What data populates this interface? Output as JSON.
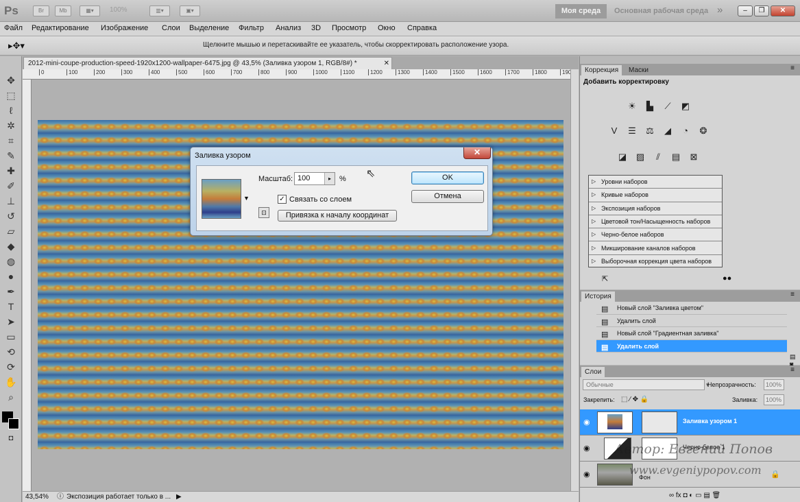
{
  "app": {
    "logo": "Ps",
    "zoom": "100%",
    "ws_active": "Моя среда",
    "ws_main": "Основная рабочая среда",
    "more": "»"
  },
  "menu": [
    "Файл",
    "Редактирование",
    "Изображение",
    "Слои",
    "Выделение",
    "Фильтр",
    "Анализ",
    "3D",
    "Просмотр",
    "Окно",
    "Справка"
  ],
  "options": {
    "hint": "Щелкните мышью и перетаскивайте ее указатель, чтобы скорректировать расположение узора."
  },
  "document": {
    "tab_title": "2012-mini-coupe-production-speed-1920x1200-wallpaper-6475.jpg @ 43,5% (Заливка узором 1, RGB/8#) *",
    "ruler_labels": [
      "0",
      "100",
      "200",
      "300",
      "400",
      "500",
      "600",
      "700",
      "800",
      "900",
      "1000",
      "1100",
      "1200",
      "1300",
      "1400",
      "1500",
      "1600",
      "1700",
      "1800",
      "190"
    ],
    "zoom_status": "43,54%",
    "status_text": "Экспозиция работает только в ..."
  },
  "dialog": {
    "title": "Заливка узором",
    "close": "✕",
    "scale_label": "Масштаб:",
    "scale_value": "100",
    "percent": "%",
    "link_label": "Связать со слоем",
    "link_checked": true,
    "origin_button": "Привязка к началу координат",
    "ok": "OK",
    "cancel": "Отмена"
  },
  "adjustments": {
    "tabs": [
      "Коррекция",
      "Маски"
    ],
    "heading": "Добавить корректировку",
    "presets": [
      "Уровни наборов",
      "Кривые наборов",
      "Экспозиция наборов",
      "Цветовой тон/Насыщенность наборов",
      "Черно-белое наборов",
      "Микширование каналов наборов",
      "Выборочная коррекция цвета наборов"
    ]
  },
  "history": {
    "tab": "История",
    "items": [
      "Новый слой \"Заливка цветом\"",
      "Удалить слой",
      "Новый слой \"Градиентная заливка\"",
      "Удалить слой"
    ],
    "selected_index": 3
  },
  "layers": {
    "tab": "Слои",
    "blend_mode": "Обычные",
    "opacity_label": "Непрозрачность:",
    "opacity": "100%",
    "lock_label": "Закрепить:",
    "fill_label": "Заливка:",
    "fill": "100%",
    "items": [
      "Заливка узором 1",
      "Черно-белое 1",
      "Фон"
    ]
  },
  "watermark": {
    "author": "Автор: Евгений Попов",
    "site": "www.evgeniypopov.com"
  },
  "colors": {
    "accent": "#3399ff",
    "dialog_blue": "#c8dcf0"
  }
}
